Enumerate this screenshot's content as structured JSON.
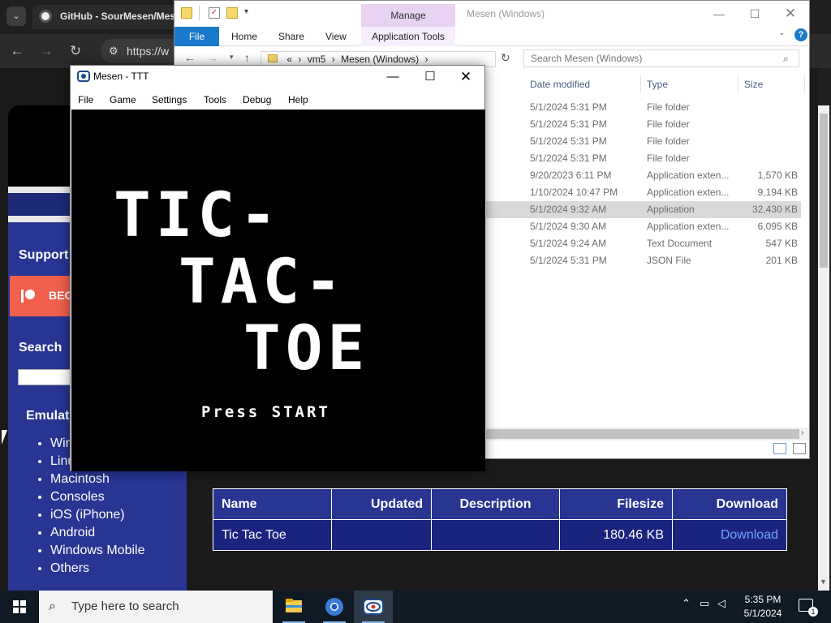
{
  "browser": {
    "tab_title": "GitHub - SourMesen/Mesen",
    "url": "https://w",
    "sidebar": {
      "support_heading": "Support",
      "patreon_label": "BEC",
      "search_heading": "Search",
      "emulators_heading": "Emulat",
      "emulator_items": [
        "Win",
        "Linu",
        "Macintosh",
        "Consoles",
        "iOS (iPhone)",
        "Android",
        "Windows Mobile",
        "Others"
      ]
    },
    "downloads_table": {
      "headers": [
        "Name",
        "Updated",
        "Description",
        "Filesize",
        "Download"
      ],
      "row": {
        "name": "Tic Tac Toe",
        "updated": "",
        "description": "",
        "filesize": "180.46 KB",
        "download": "Download"
      }
    }
  },
  "explorer": {
    "title": "Mesen (Windows)",
    "manage_label": "Manage",
    "ribbon": {
      "file": "File",
      "home": "Home",
      "share": "Share",
      "view": "View",
      "app_tools": "Application Tools"
    },
    "address": {
      "chevrons": "«",
      "parts": [
        "vm5",
        "Mesen (Windows)"
      ]
    },
    "search_placeholder": "Search Mesen (Windows)",
    "columns": {
      "date": "Date modified",
      "type": "Type",
      "size": "Size"
    },
    "rows": [
      {
        "date": "5/1/2024 5:31 PM",
        "type": "File folder",
        "size": ""
      },
      {
        "date": "5/1/2024 5:31 PM",
        "type": "File folder",
        "size": ""
      },
      {
        "date": "5/1/2024 5:31 PM",
        "type": "File folder",
        "size": ""
      },
      {
        "date": "5/1/2024 5:31 PM",
        "type": "File folder",
        "size": ""
      },
      {
        "date": "9/20/2023 6:11 PM",
        "type": "Application exten...",
        "size": "1,570 KB"
      },
      {
        "date": "1/10/2024 10:47 PM",
        "type": "Application exten...",
        "size": "9,194 KB"
      },
      {
        "date": "5/1/2024 9:32 AM",
        "type": "Application",
        "size": "32,430 KB"
      },
      {
        "date": "5/1/2024 9:30 AM",
        "type": "Application exten...",
        "size": "6,095 KB"
      },
      {
        "date": "5/1/2024 9:24 AM",
        "type": "Text Document",
        "size": "547 KB"
      },
      {
        "date": "5/1/2024 5:31 PM",
        "type": "JSON File",
        "size": "201 KB"
      }
    ],
    "selected_row": 6
  },
  "mesen": {
    "title": "Mesen - TTT",
    "menu": [
      "File",
      "Game",
      "Settings",
      "Tools",
      "Debug",
      "Help"
    ],
    "game": {
      "title_lines": [
        "TIC-",
        "TAC-",
        "TOE"
      ],
      "prompt": "Press START"
    }
  },
  "taskbar": {
    "search_placeholder": "Type here to search",
    "time": "5:35 PM",
    "date": "5/1/2024",
    "notification_count": "1"
  },
  "colors": {
    "sidebar_navy": "#283593",
    "table_row": "#1a237e",
    "explorer_accent": "#1979ca",
    "manage_tab": "#e8d3f3",
    "patreon": "#f0604d",
    "link": "#6ea6ff"
  }
}
